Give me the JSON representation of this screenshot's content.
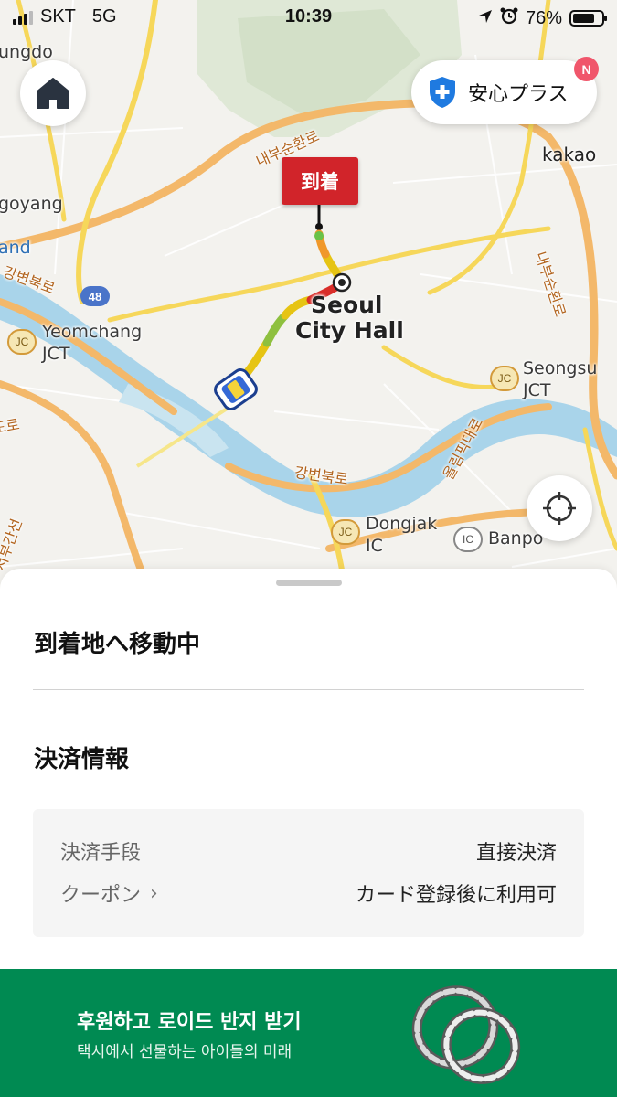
{
  "status_bar": {
    "carrier": "SKT",
    "network": "5G",
    "time": "10:39",
    "battery": "76%",
    "battery_level": 0.76
  },
  "map": {
    "labels": {
      "ungdo": "ungdo",
      "goyang": "goyang",
      "and": "and",
      "yeomchang": "Yeomchang",
      "jct": "JCT",
      "seoul": "Seoul",
      "city_hall": "City Hall",
      "seongsu": "Seongsu",
      "dongjak": "Dongjak",
      "ic": "IC",
      "banpo": "Banpo",
      "kakao": "kakao"
    },
    "route_badge": "48",
    "jc_badge": "JC",
    "ic_badge": "IC",
    "road_labels": {
      "naebu_top": "내부순환로",
      "naebu_right": "내부순환로",
      "gangbyeon_left": "강변북로",
      "gangbyeon_bottom": "강변북로",
      "olympic": "올림픽대로",
      "left_edge": "도로",
      "left_bottom": "서부간선"
    }
  },
  "buttons": {
    "anshin_plus": "安心プラス",
    "anshin_badge": "N"
  },
  "destination_tag": "到着",
  "sheet": {
    "status_title": "到着地へ移動中",
    "payment_title": "決済情報",
    "payment_method_label": "決済手段",
    "payment_method_value": "直接決済",
    "coupon_label": "クーポン",
    "coupon_value": "カード登録後に利用可"
  },
  "banner": {
    "title": "후원하고 로이드 반지 받기",
    "subtitle": "택시에서 선물하는 아이들의 미래"
  },
  "colors": {
    "brand_green": "#008a52",
    "destination_red": "#d1242a",
    "shield_blue": "#1f7ae0",
    "badge_pink": "#f0566b",
    "river": "#a9d4ea"
  }
}
